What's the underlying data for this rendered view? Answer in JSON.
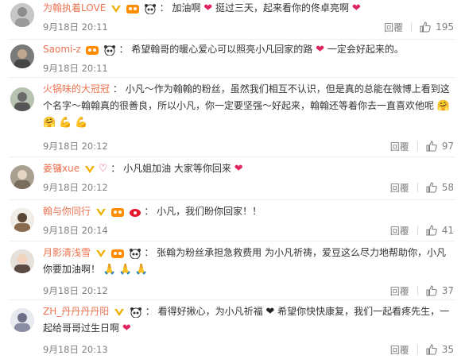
{
  "comments": [
    {
      "user": "为翰执着LOVE",
      "badges": [
        "vip",
        "fan"
      ],
      "parts": [
        "加油啊",
        "挺过三天，起来看你的佟卓亮啊"
      ],
      "time": "9月18日 20:11",
      "reply": "回覆",
      "likes": "195"
    },
    {
      "user": "Saomi-z",
      "badges": [
        "fan"
      ],
      "parts": [
        "希望翰哥的暖心爱心可以照亮小凡回家的路",
        "一定会好起来的。"
      ],
      "time": "9月18日 20:11",
      "reply": "回覆",
      "likes": ""
    },
    {
      "user": "火锅味的大冠冠",
      "badges": [],
      "parts": [
        "小凡～作为翰翰的粉丝，虽然我们相互不认识，但是真的总能在微博上看到这个名字～翰翰真的很善良，所以小凡，你一定要坚强～好起来，翰翰还等着你去一直喜欢他呢"
      ],
      "time": "9月18日 20:12",
      "reply": "回覆",
      "likes": "97"
    },
    {
      "user": "姜镛xue",
      "badges": [
        "vip"
      ],
      "parts": [
        "小凡姐加油 大家等你回来"
      ],
      "time": "9月18日 20:12",
      "reply": "回覆",
      "likes": "58"
    },
    {
      "user": "翰与你同行",
      "badges": [
        "vip",
        "fan"
      ],
      "parts": [
        "小凡，我们盼你回家！！"
      ],
      "time": "9月18日 20:14",
      "reply": "回覆",
      "likes": "41"
    },
    {
      "user": "月影清浅雪",
      "badges": [
        "vip",
        "fan"
      ],
      "parts": [
        "张翰为粉丝承担急救费用 为小凡祈祷，爱豆这么尽力地帮助你，小凡你要加油啊！"
      ],
      "time": "9月18日 20:12",
      "reply": "回覆",
      "likes": "37"
    },
    {
      "user": "ZH_丹丹丹丹阳",
      "badges": [
        "vip"
      ],
      "parts": [
        "看得好揪心，为小凡祈福",
        "希望你快快康复，我们一起看疼先生，一起给哥哥过生日啊"
      ],
      "time": "9月18日 20:13",
      "reply": "回覆",
      "likes": "35"
    }
  ],
  "colors": {
    "username": "#eb7350",
    "meta": "#808080",
    "heart": "#e0245e",
    "vip_badge": "#f0b000"
  },
  "icons": {
    "like": "thumbs-up-icon",
    "panda": "panda-icon",
    "heart": "heart-icon",
    "pray": "pray-icon",
    "muscle": "muscle-icon"
  }
}
